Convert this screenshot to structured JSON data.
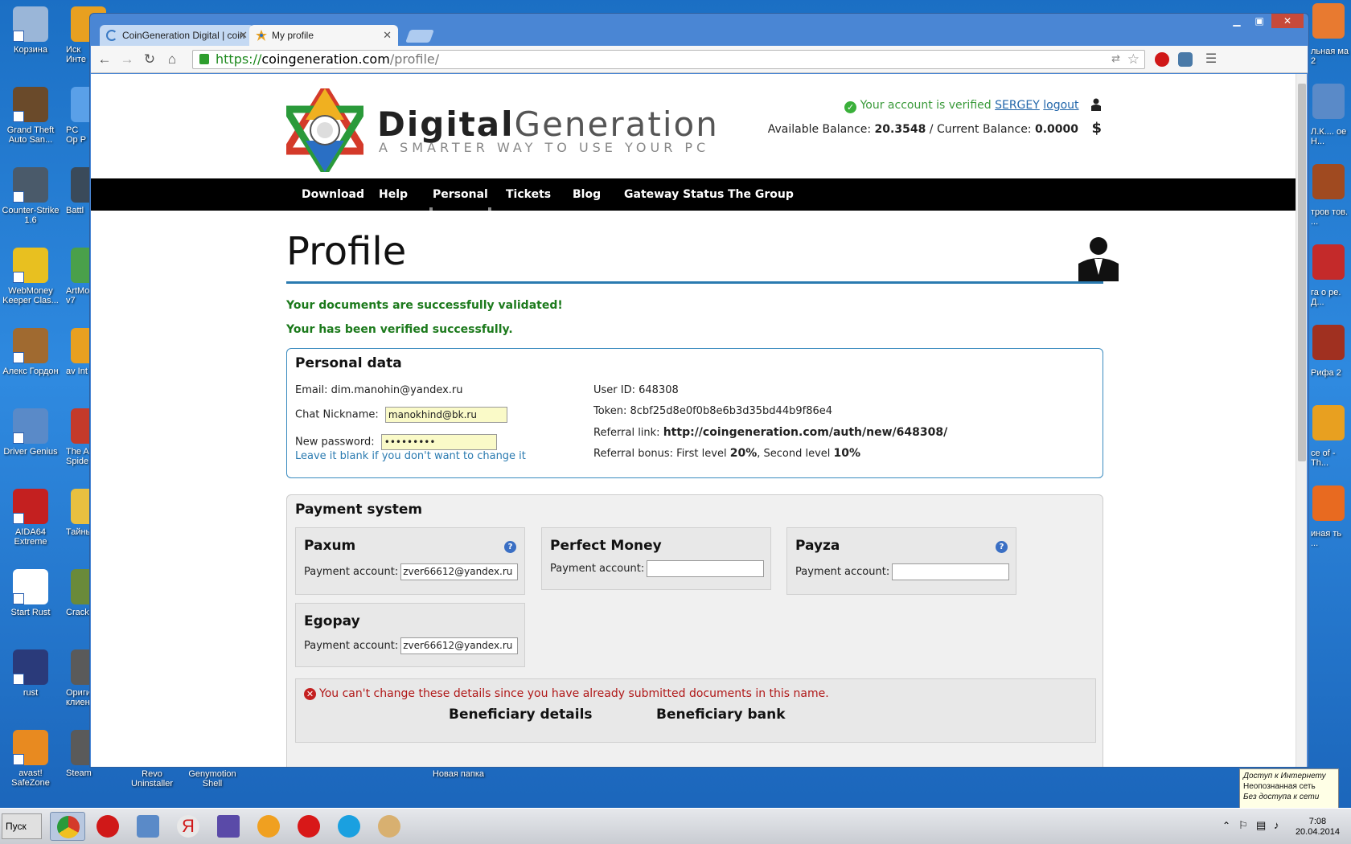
{
  "desktop": {
    "left_icons": [
      {
        "label": "Корзина",
        "color": "#9ab6d8"
      },
      {
        "label": "Grand Theft Auto San...",
        "color": "#6a4a2a"
      },
      {
        "label": "Counter-Strike 1.6",
        "color": "#4a5a6a"
      },
      {
        "label": "WebMoney Keeper Clas...",
        "color": "#e8c020"
      },
      {
        "label": "Алекс Гордон",
        "color": "#a06a30"
      },
      {
        "label": "Driver Genius",
        "color": "#5a8ac8"
      },
      {
        "label": "AIDA64 Extreme",
        "color": "#c42020"
      },
      {
        "label": "Start Rust",
        "color": "#ffffff"
      },
      {
        "label": "rust",
        "color": "#2a3a7a"
      },
      {
        "label": "avast! SafeZone",
        "color": "#e88a20"
      }
    ],
    "col2_labels": [
      "Иск Инте",
      "PC Op P",
      "Battl",
      "ArtMo v7",
      "av Int",
      "The A Spide",
      "Тайны",
      "Cracke",
      "Ориги клиен",
      "Steam"
    ],
    "right_labels": [
      "льная ма 2",
      "Л.К.... ое Н...",
      "тров тов. ...",
      "га о ре. Д...",
      "Рифа 2",
      "ce of - Th...",
      "иная ть ..."
    ],
    "bottom_labels": [
      "Revo Uninstaller",
      "Genymotion Shell",
      "Новая папка"
    ]
  },
  "browser": {
    "tabs": [
      {
        "label": "CoinGeneration Digital | coin",
        "active": false
      },
      {
        "label": "My profile",
        "active": true
      }
    ],
    "url_scheme": "https://",
    "url_host": "coingeneration.com",
    "url_path": "/profile/"
  },
  "page": {
    "brand_bold": "Digital",
    "brand_light": "Generation",
    "tagline": "A SMARTER WAY TO USE YOUR PC",
    "account": {
      "verified_text": "Your account is verified",
      "username": "SERGEY",
      "logout": "logout",
      "available_label": "Available Balance:",
      "available_value": "20.3548",
      "separator": "/",
      "current_label": "Current Balance:",
      "current_value": "0.0000",
      "currency_symbol": "$"
    },
    "nav": [
      "Download",
      "Help",
      "Personal",
      "Tickets",
      "Blog",
      "Gateway Status",
      "The Group"
    ],
    "title": "Profile",
    "messages": [
      "Your documents are successfully validated!",
      "Your has been verified successfully."
    ],
    "personal": {
      "title": "Personal data",
      "email_label": "Email:",
      "email": "dim.manohin@yandex.ru",
      "nickname_label": "Chat Nickname:",
      "nickname": "manokhind@bk.ru",
      "password_label": "New password:",
      "password": "•••••••••",
      "hint": "Leave it blank if you don't want to change it",
      "userid_label": "User ID:",
      "userid": "648308",
      "token_label": "Token:",
      "token": "8cbf25d8e0f0b8e6b3d35bd44b9f86e4",
      "referral_label": "Referral link:",
      "referral_link": "http://coingeneration.com/auth/new/648308/",
      "bonus_label": "Referral bonus: First level",
      "bonus_first": "20%",
      "bonus_mid": ", Second level",
      "bonus_second": "10%"
    },
    "payment": {
      "title": "Payment system",
      "account_label": "Payment account:",
      "systems": [
        {
          "name": "Paxum",
          "value": "zver66612@yandex.ru",
          "help": "?"
        },
        {
          "name": "Perfect Money",
          "value": "",
          "help": ""
        },
        {
          "name": "Payza",
          "value": "",
          "help": "?"
        },
        {
          "name": "Egopay",
          "value": "zver66612@yandex.ru",
          "help": ""
        }
      ],
      "error": "You can't change these details since you have already submitted documents in this name.",
      "beneficiary_details": "Beneficiary details",
      "beneficiary_bank": "Beneficiary bank"
    }
  },
  "system": {
    "start_label": "Пуск",
    "network_popup": [
      "Доступ к Интернету",
      "Неопознанная сеть",
      "Без доступа к сети"
    ],
    "time": "7:08",
    "date": "20.04.2014"
  }
}
